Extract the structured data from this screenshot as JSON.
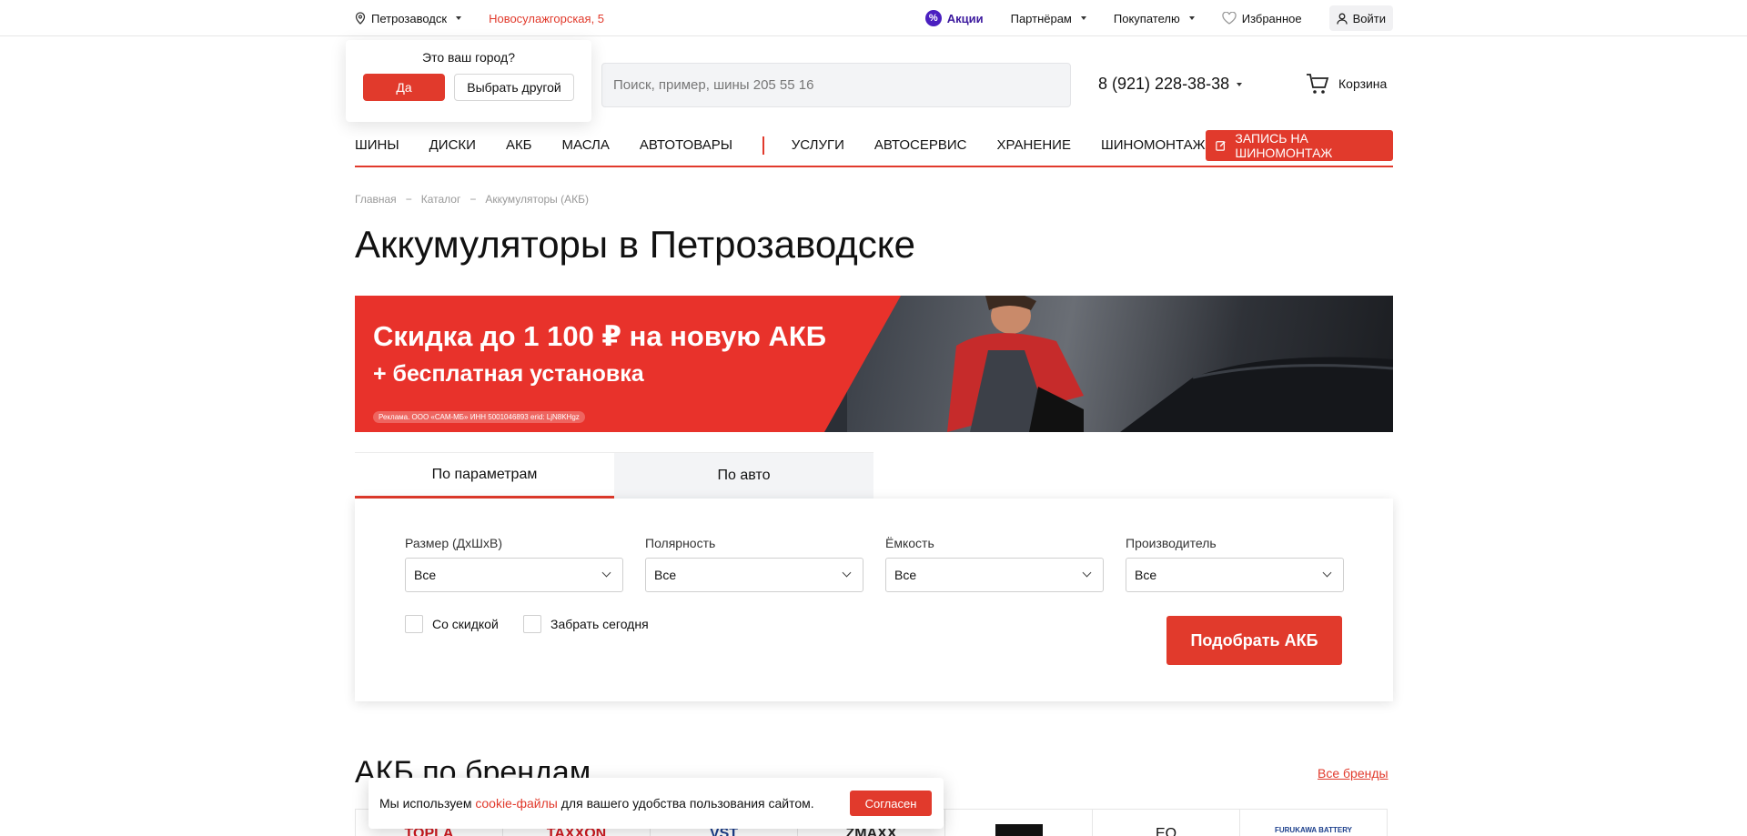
{
  "topbar": {
    "city": "Петрозаводск",
    "address": "Новосулажгорская, 5",
    "promo": "Акции",
    "partners": "Партнёрам",
    "buyer": "Покупателю",
    "favorites": "Избранное",
    "login": "Войти"
  },
  "city_popup": {
    "question": "Это ваш город?",
    "yes": "Да",
    "other": "Выбрать другой"
  },
  "header": {
    "search_placeholder": "Поиск, пример, шины 205 55 16",
    "phone": "8 (921) 228-38-38",
    "cart": "Корзина"
  },
  "nav": {
    "items_left": [
      "ШИНЫ",
      "ДИСКИ",
      "АКБ",
      "МАСЛА",
      "АВТОТОВАРЫ"
    ],
    "items_right": [
      "УСЛУГИ",
      "АВТОСЕРВИС",
      "ХРАНЕНИЕ",
      "ШИНОМОНТАЖ"
    ],
    "book": "ЗАПИСЬ НА ШИНОМОНТАЖ"
  },
  "breadcrumb": [
    "Главная",
    "Каталог",
    "Аккумуляторы (АКБ)"
  ],
  "breadcrumb_sep": "−",
  "page_title": "Аккумуляторы в Петрозаводске",
  "banner": {
    "line1": "Скидка до 1 100 ₽ на новую АКБ",
    "line2": "+ бесплатная установка",
    "legal": "Реклама. ООО «САМ-МБ» ИНН 5001046893 erid: LjN8KHgz"
  },
  "filter": {
    "tabs": [
      "По параметрам",
      "По авто"
    ],
    "fields": [
      {
        "label": "Размер (ДхШхВ)",
        "value": "Все"
      },
      {
        "label": "Полярность",
        "value": "Все"
      },
      {
        "label": "Ёмкость",
        "value": "Все"
      },
      {
        "label": "Производитель",
        "value": "Все"
      }
    ],
    "checkboxes": [
      "Со скидкой",
      "Забрать сегодня"
    ],
    "submit": "Подобрать АКБ"
  },
  "brands": {
    "title": "АКБ по брендам",
    "all": "Все бренды",
    "items": [
      "TOPLA",
      "TAXXON",
      "VST",
      "ZMAXX",
      "",
      "EQ",
      "FURUKAWA BATTERY"
    ]
  },
  "cookie": {
    "text_before": "Мы используем ",
    "link": "cookie-файлы",
    "text_after": " для вашего удобства пользования сайтом.",
    "accept": "Согласен"
  },
  "colors": {
    "accent": "#e13a2c",
    "promo": "#4a1fc0"
  }
}
